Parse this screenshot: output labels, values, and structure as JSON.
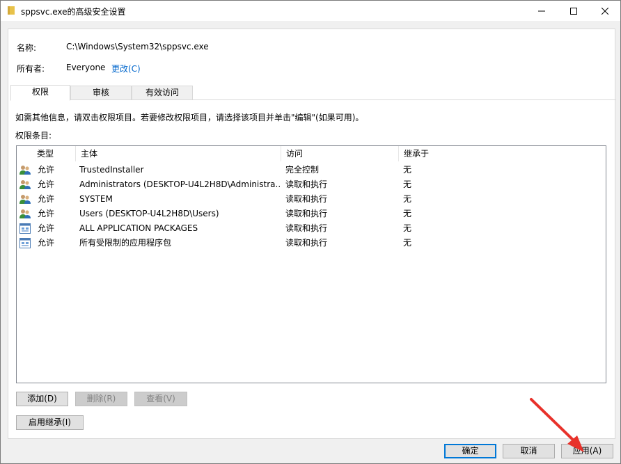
{
  "window": {
    "title": "sppsvc.exe的高级安全设置",
    "minimize_label": "minimize",
    "maximize_label": "maximize",
    "close_label": "close"
  },
  "info": {
    "name_label": "名称:",
    "name_value": "C:\\Windows\\System32\\sppsvc.exe",
    "owner_label": "所有者:",
    "owner_value": "Everyone",
    "change_link": "更改(C)"
  },
  "tabs": [
    {
      "label": "权限",
      "active": true
    },
    {
      "label": "审核",
      "active": false
    },
    {
      "label": "有效访问",
      "active": false
    }
  ],
  "permissions": {
    "hint": "如需其他信息，请双击权限项目。若要修改权限项目，请选择该项目并单击\"编辑\"(如果可用)。",
    "entries_label": "权限条目:",
    "columns": [
      "类型",
      "主体",
      "访问",
      "继承于"
    ],
    "rows": [
      {
        "icon": "users-icon",
        "type": "允许",
        "principal": "TrustedInstaller",
        "access": "完全控制",
        "inherited": "无"
      },
      {
        "icon": "users-icon",
        "type": "允许",
        "principal": "Administrators (DESKTOP-U4L2H8D\\Administra...",
        "access": "读取和执行",
        "inherited": "无"
      },
      {
        "icon": "users-icon",
        "type": "允许",
        "principal": "SYSTEM",
        "access": "读取和执行",
        "inherited": "无"
      },
      {
        "icon": "users-icon",
        "type": "允许",
        "principal": "Users (DESKTOP-U4L2H8D\\Users)",
        "access": "读取和执行",
        "inherited": "无"
      },
      {
        "icon": "app-package-icon",
        "type": "允许",
        "principal": "ALL APPLICATION PACKAGES",
        "access": "读取和执行",
        "inherited": "无"
      },
      {
        "icon": "app-package-icon",
        "type": "允许",
        "principal": "所有受限制的应用程序包",
        "access": "读取和执行",
        "inherited": "无"
      }
    ]
  },
  "buttons": {
    "add": "添加(D)",
    "remove": "删除(R)",
    "view": "查看(V)",
    "enable_inheritance": "启用继承(I)",
    "ok": "确定",
    "cancel": "取消",
    "apply": "应用(A)"
  },
  "colors": {
    "link": "#0066cc",
    "annotation_arrow": "#e8312a",
    "primary_border": "#0078d7"
  }
}
